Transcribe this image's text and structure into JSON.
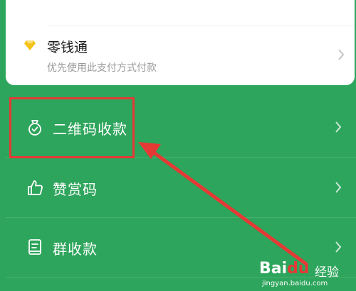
{
  "wallet": {
    "title": "零钱通",
    "subtitle": "优先使用此支付方式付款",
    "icon": "diamond-icon"
  },
  "menu": {
    "items": [
      {
        "label": "二维码收款",
        "icon": "money-bag-icon"
      },
      {
        "label": "赞赏码",
        "icon": "thumbs-up-icon"
      },
      {
        "label": "群收款",
        "icon": "group-bill-icon"
      }
    ]
  },
  "watermark": {
    "logo_text": "Bai",
    "logo_paw": "du",
    "brand": "经验",
    "url": "jingyan.baidu.com"
  },
  "colors": {
    "background": "#2ea55c",
    "highlight": "#e53935",
    "diamond": "#f5c316"
  }
}
